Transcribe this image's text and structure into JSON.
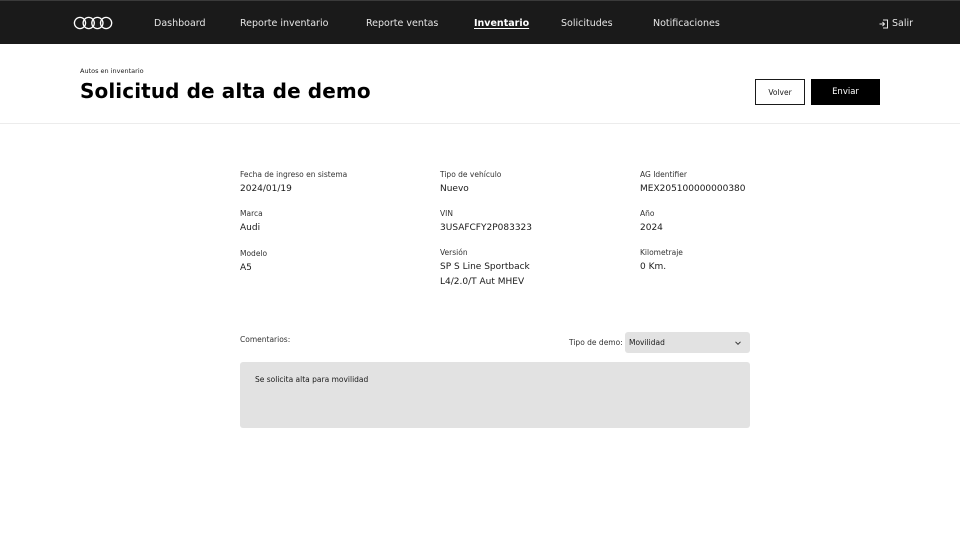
{
  "nav": {
    "items": [
      {
        "label": "Dashboard"
      },
      {
        "label": "Reporte inventario"
      },
      {
        "label": "Reporte ventas"
      },
      {
        "label": "Inventario"
      },
      {
        "label": "Solicitudes"
      },
      {
        "label": "Notificaciones"
      }
    ],
    "active": "Inventario",
    "logout_label": "Salir",
    "logo_icon": "audi-rings-logo",
    "logout_icon": "logout-icon"
  },
  "header": {
    "breadcrumb": "Autos en inventario",
    "title": "Solicitud de alta de demo",
    "back_label": "Volver",
    "send_label": "Enviar"
  },
  "details": {
    "fecha": {
      "label": "Fecha de ingreso en sistema",
      "value": "2024/01/19"
    },
    "tipo": {
      "label": "Tipo de vehículo",
      "value": "Nuevo"
    },
    "ag": {
      "label": "AG Identifier",
      "value": "MEX205100000000380"
    },
    "marca": {
      "label": "Marca",
      "value": "Audi"
    },
    "vin": {
      "label": "VIN",
      "value": "3USAFCFY2P083323"
    },
    "anio": {
      "label": "Año",
      "value": "2024"
    },
    "modelo": {
      "label": "Modelo",
      "value": "A5"
    },
    "version": {
      "label": "Versión",
      "value_line1": "SP S Line Sportback",
      "value_line2": "L4/2.0/T Aut MHEV"
    },
    "km": {
      "label": "Kilometraje",
      "value": "0 Km."
    }
  },
  "comments": {
    "label": "Comentarios:",
    "demo_type_label": "Tipo de demo:",
    "demo_type_value": "Movilidad",
    "text": "Se solicita alta para movilidad"
  },
  "colors": {
    "topbar": "#1a1a1a",
    "primary_button": "#000000",
    "input_background": "#e2e2e2"
  }
}
